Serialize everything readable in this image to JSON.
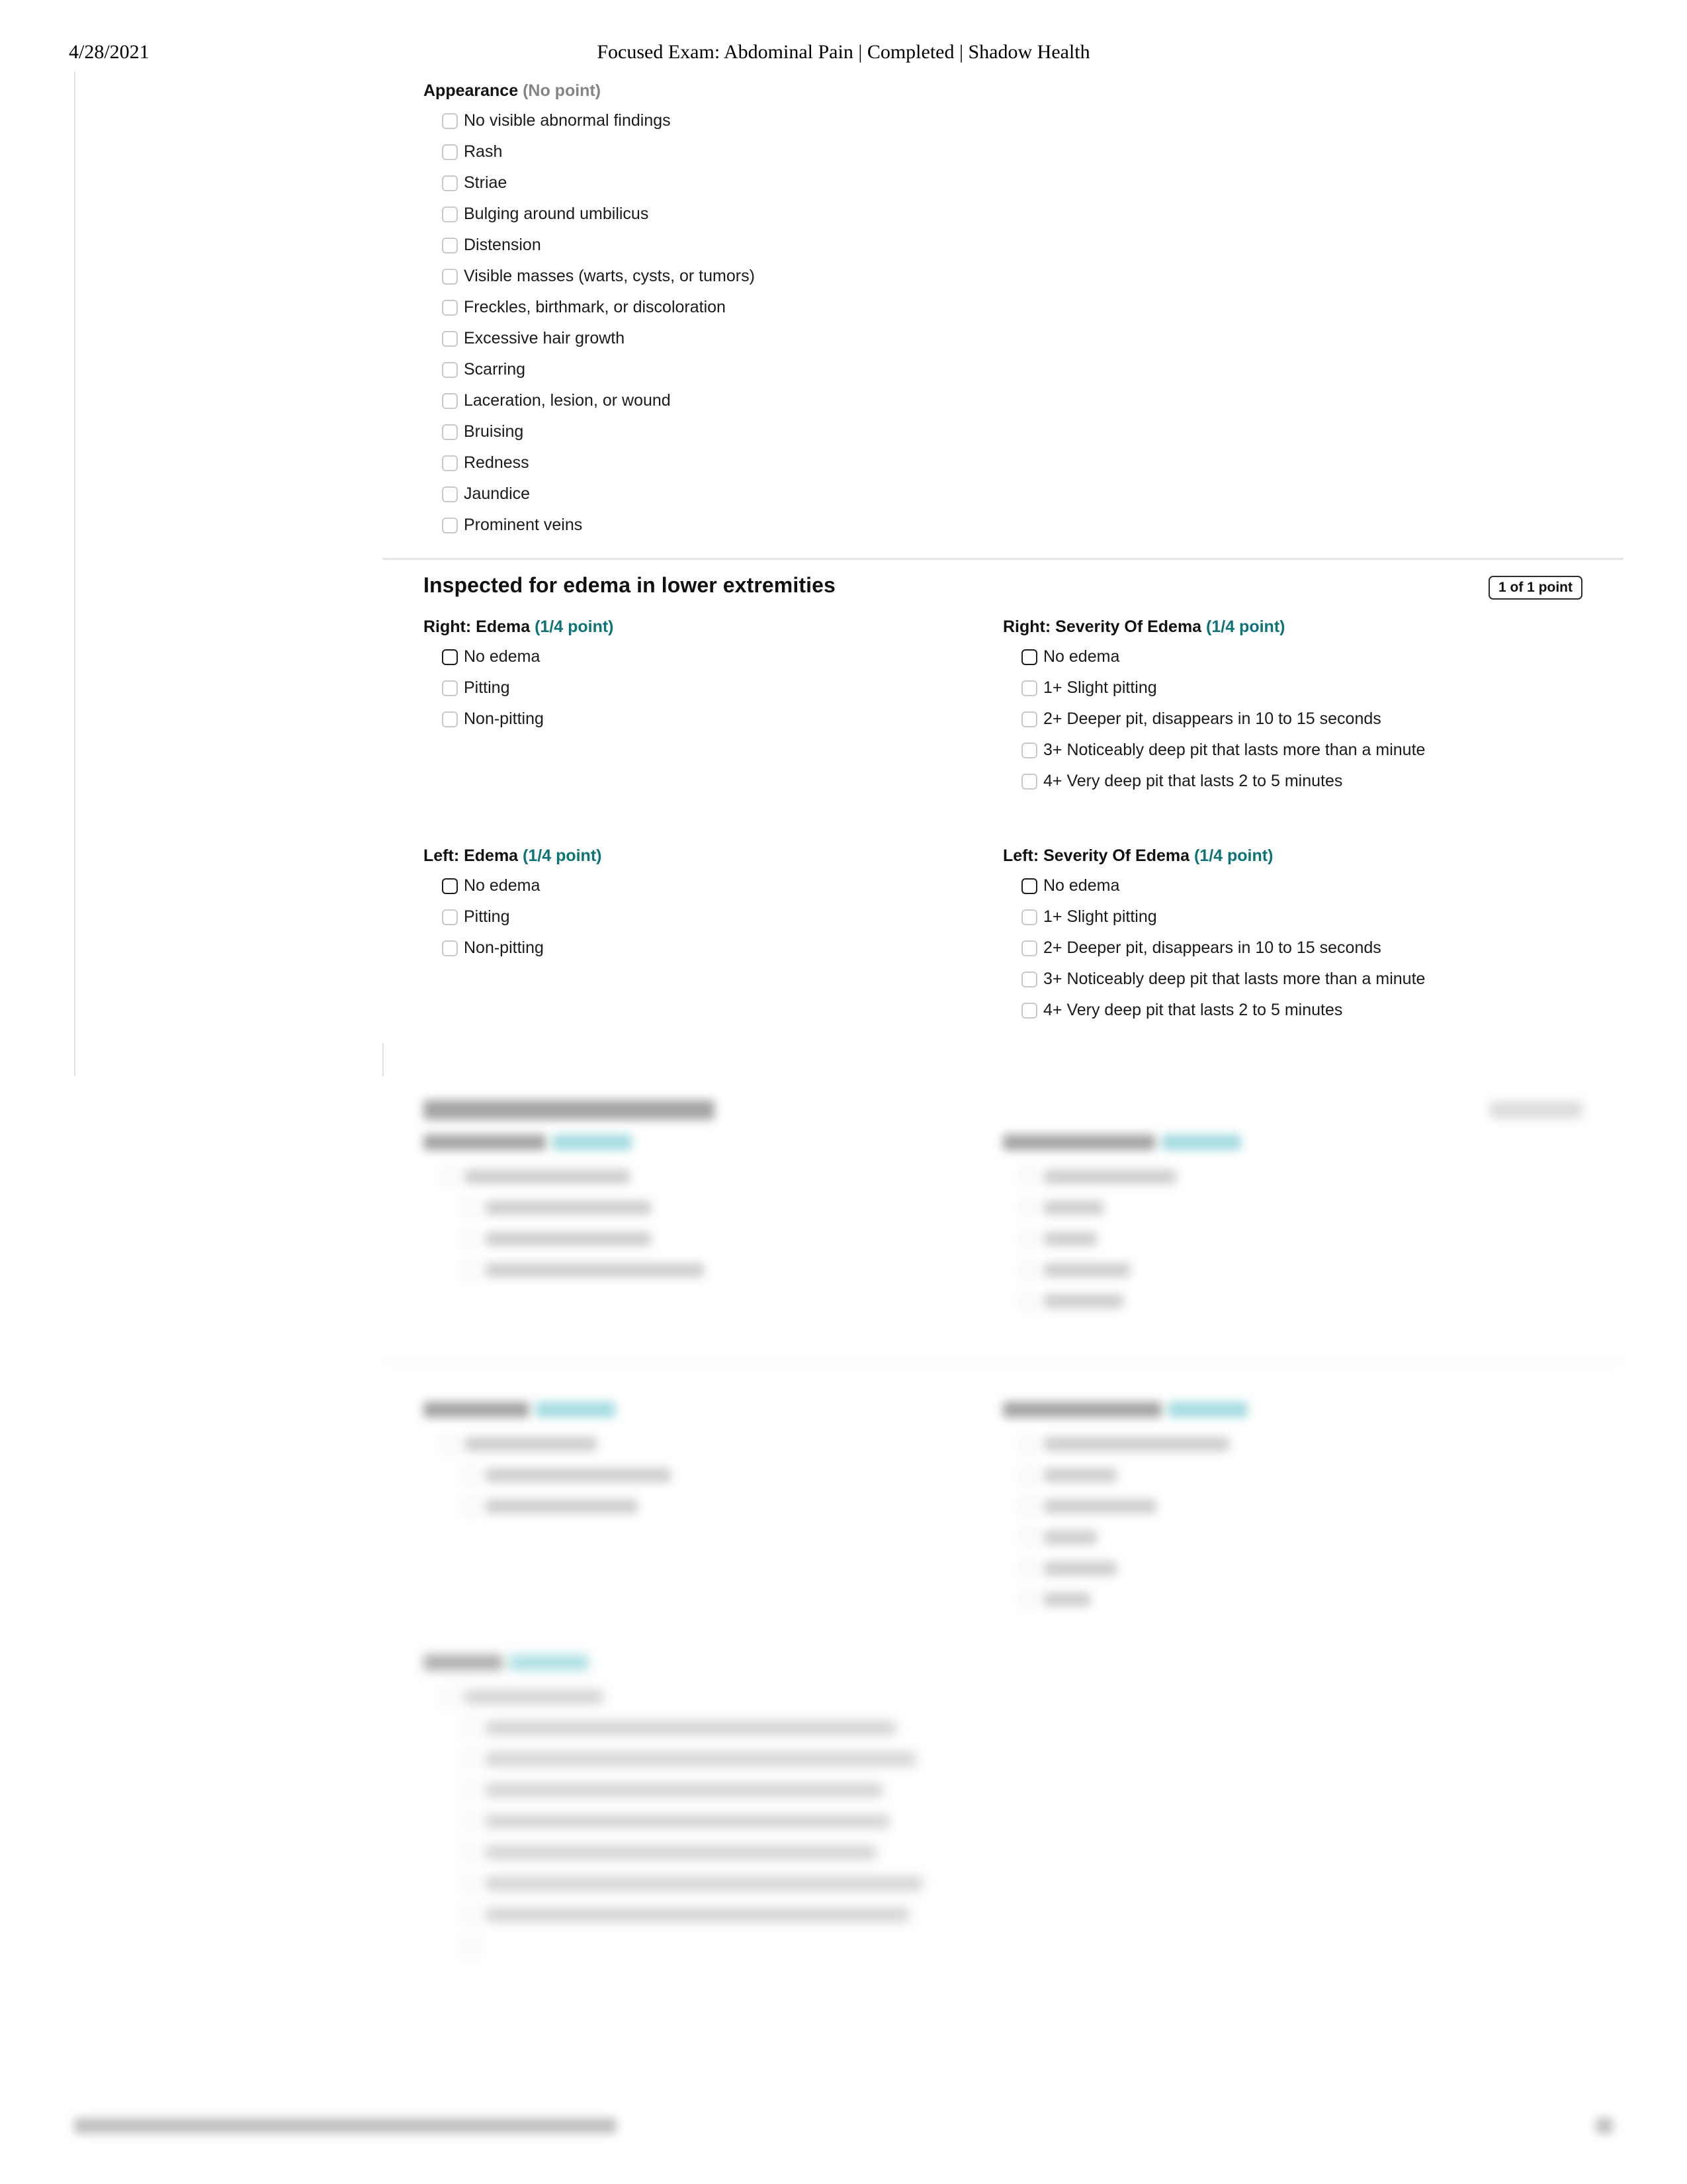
{
  "print_header": {
    "date": "4/28/2021",
    "title": "Focused Exam: Abdominal Pain | Completed | Shadow Health"
  },
  "appearance_section": {
    "group_title": "Appearance",
    "points_label": "(No point)",
    "options": [
      "No visible abnormal findings",
      "Rash",
      "Striae",
      "Bulging around umbilicus",
      "Distension",
      "Visible masses (warts, cysts, or tumors)",
      "Freckles, birthmark, or discoloration",
      "Excessive hair growth",
      "Scarring",
      "Laceration, lesion, or wound",
      "Bruising",
      "Redness",
      "Jaundice",
      "Prominent veins"
    ]
  },
  "edema_section": {
    "title": "Inspected for edema in lower extremities",
    "badge": "1 of 1 point",
    "groups": [
      {
        "title": "Right: Edema",
        "points_label": "(1/4 point)",
        "selected_index": 0,
        "options": [
          "No edema",
          "Pitting",
          "Non-pitting"
        ]
      },
      {
        "title": "Right: Severity Of Edema",
        "points_label": "(1/4 point)",
        "selected_index": 0,
        "options": [
          "No edema",
          "1+ Slight pitting",
          "2+ Deeper pit, disappears in 10 to 15 seconds",
          "3+ Noticeably deep pit that lasts more than a minute",
          "4+ Very deep pit that lasts 2 to 5 minutes"
        ]
      },
      {
        "title": "Left: Edema",
        "points_label": "(1/4 point)",
        "selected_index": 0,
        "options": [
          "No edema",
          "Pitting",
          "Non-pitting"
        ]
      },
      {
        "title": "Left: Severity Of Edema",
        "points_label": "(1/4 point)",
        "selected_index": 0,
        "options": [
          "No edema",
          "1+ Slight pitting",
          "2+ Deeper pit, disappears in 10 to 15 seconds",
          "3+ Noticeably deep pit that lasts more than a minute",
          "4+ Very deep pit that lasts 2 to 5 minutes"
        ]
      }
    ]
  },
  "obscured_content": {
    "note": "redacted-blurred",
    "accent_color": "#6fc7cf"
  },
  "colors": {
    "point_teal": "#0d7377",
    "no_point_gray": "#848484",
    "checkbox_border": "#c9c9c9",
    "checkbox_border_marked": "#1b1b1b",
    "rule": "#e2e2e2"
  }
}
